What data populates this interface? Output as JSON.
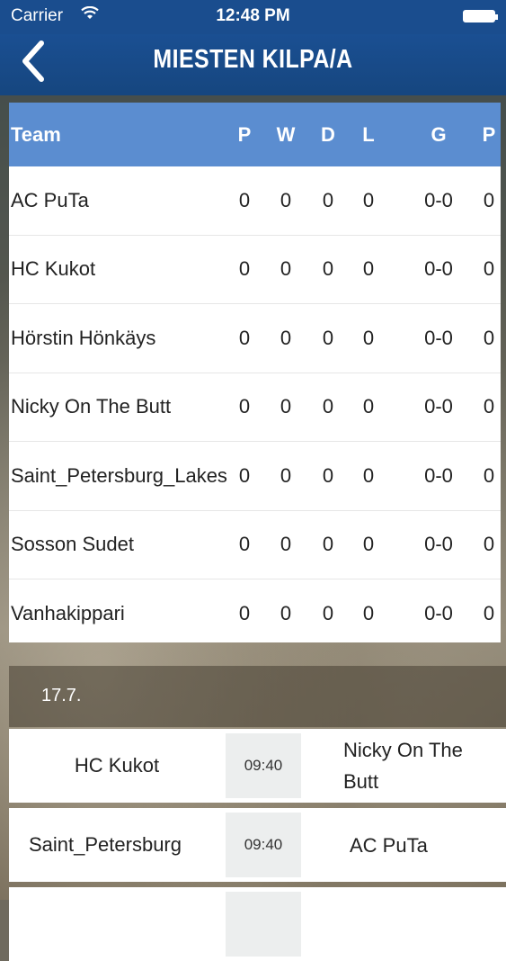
{
  "status_bar": {
    "carrier": "Carrier",
    "time": "12:48 PM"
  },
  "nav": {
    "title": "MIESTEN KILPA/A"
  },
  "standings": {
    "headers": {
      "team": "Team",
      "played": "P",
      "won": "W",
      "drawn": "D",
      "lost": "L",
      "goals": "G",
      "points": "P"
    },
    "rows": [
      {
        "team": "AC PuTa",
        "p": "0",
        "w": "0",
        "d": "0",
        "l": "0",
        "g": "0-0",
        "pts": "0"
      },
      {
        "team": "HC Kukot",
        "p": "0",
        "w": "0",
        "d": "0",
        "l": "0",
        "g": "0-0",
        "pts": "0"
      },
      {
        "team": "Hörstin Hönkäys",
        "p": "0",
        "w": "0",
        "d": "0",
        "l": "0",
        "g": "0-0",
        "pts": "0"
      },
      {
        "team": "Nicky On The Butt",
        "p": "0",
        "w": "0",
        "d": "0",
        "l": "0",
        "g": "0-0",
        "pts": "0"
      },
      {
        "team": "Saint_Petersburg_Lakes",
        "p": "0",
        "w": "0",
        "d": "0",
        "l": "0",
        "g": "0-0",
        "pts": "0"
      },
      {
        "team": "Sosson Sudet",
        "p": "0",
        "w": "0",
        "d": "0",
        "l": "0",
        "g": "0-0",
        "pts": "0"
      },
      {
        "team": "Vanhakippari",
        "p": "0",
        "w": "0",
        "d": "0",
        "l": "0",
        "g": "0-0",
        "pts": "0"
      }
    ]
  },
  "schedule": {
    "date": "17.7.",
    "matches": [
      {
        "home": "HC Kukot",
        "time": "09:40",
        "away": "Nicky On The Butt"
      },
      {
        "home": "Saint_Petersburg",
        "time": "09:40",
        "away": "AC PuTa"
      }
    ]
  }
}
